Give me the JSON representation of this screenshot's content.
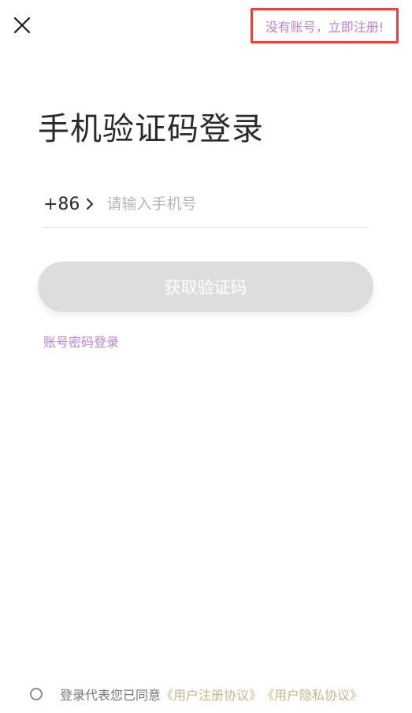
{
  "header": {
    "close_icon": "close-icon",
    "register_link": "没有账号，立即注册!"
  },
  "main": {
    "title": "手机验证码登录",
    "phone": {
      "country_code": "+86",
      "chevron_icon": "chevron-right-icon",
      "value": "",
      "placeholder": "请输入手机号"
    },
    "get_code_button": "获取验证码",
    "password_login_link": "账号密码登录"
  },
  "footer": {
    "agreement_prefix": "登录代表您已同意",
    "user_agreement": "《用户注册协议》",
    "privacy_agreement": "《用户隐私协议》"
  },
  "colors": {
    "accent": "#b884d6",
    "highlight_border": "#e8413f",
    "link_gold": "#c9b58a",
    "button_disabled": "#dddddd"
  }
}
